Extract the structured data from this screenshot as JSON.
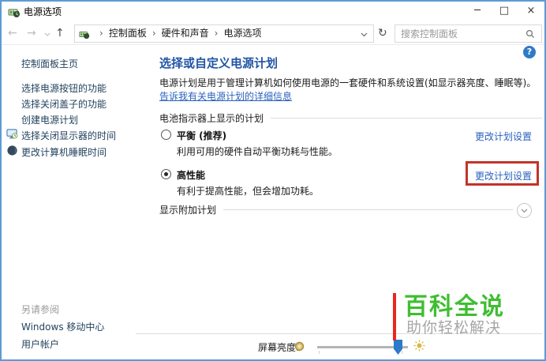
{
  "window": {
    "title": "电源选项"
  },
  "icons": {
    "minimize": "─",
    "maximize": "□",
    "close": "×",
    "back": "←",
    "forward": "→",
    "up": "↑",
    "refresh": "↻",
    "crumb_sep": "›",
    "help": "?"
  },
  "navbar": {
    "breadcrumb": [
      "控制面板",
      "硬件和声音",
      "电源选项"
    ],
    "search_placeholder": "搜索控制面板"
  },
  "sidebar": {
    "home": "控制面板主页",
    "tasks": [
      "选择电源按钮的功能",
      "选择关闭盖子的功能",
      "创建电源计划",
      "选择关闭显示器的时间",
      "更改计算机睡眠时间"
    ],
    "see_also_header": "另请参阅",
    "see_also": [
      "Windows 移动中心",
      "用户帐户"
    ]
  },
  "main": {
    "heading": "选择或自定义电源计划",
    "description": "电源计划是用于管理计算机如何使用电源的一套硬件和系统设置(如显示器亮度、睡眠等)。",
    "learn_more": "告诉我有关电源计划的详细信息",
    "battery_section": "电池指示器上显示的计划",
    "plans": [
      {
        "name": "平衡 (推荐)",
        "selected": false,
        "description": "利用可用的硬件自动平衡功耗与性能。",
        "settings_link": "更改计划设置",
        "highlighted": false
      },
      {
        "name": "高性能",
        "selected": true,
        "description": "有利于提高性能，但会增加功耗。",
        "settings_link": "更改计划设置",
        "highlighted": true
      }
    ],
    "additional_plans": "显示附加计划"
  },
  "bottom_bar": {
    "brightness_label": "屏幕亮度:",
    "brightness_percent": 85
  },
  "watermark": {
    "title": "百科全说",
    "subtitle": "助你轻松解决"
  },
  "colors": {
    "window_border": "#5b9bd5",
    "heading": "#2155a4",
    "link": "#2a62bf",
    "highlight_box": "#c23428",
    "watermark_green": "#3fbe30",
    "watermark_red": "#e8271f"
  }
}
